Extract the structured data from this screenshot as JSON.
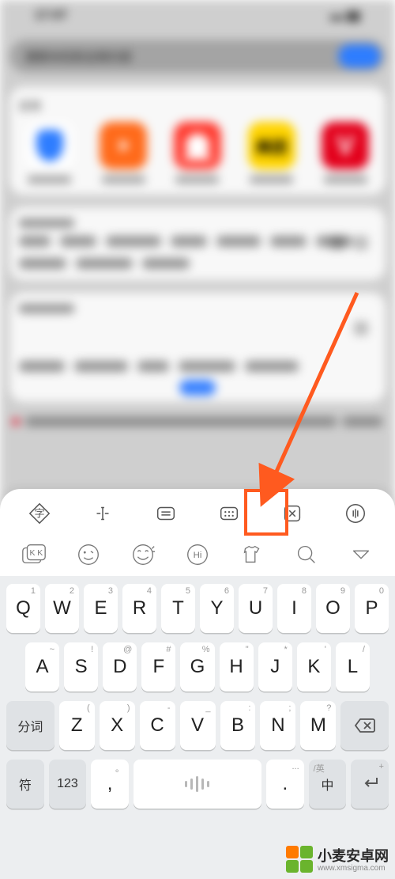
{
  "statusbar": {
    "time": "17:07"
  },
  "search": {
    "placeholder": "搜索本机和全网内容"
  },
  "apps_card": {
    "title": "应用",
    "items": [
      {
        "label": "手机管家",
        "icon": "shield-blue"
      },
      {
        "label": "华为视频",
        "icon": "play-orange"
      },
      {
        "label": "微博",
        "icon": "weibo-red"
      },
      {
        "label": "美团",
        "icon": "meituan-yellow"
      },
      {
        "label": "华为商城",
        "icon": "vmall-red"
      }
    ]
  },
  "toolbar1": [
    {
      "name": "zi-icon"
    },
    {
      "name": "cursor-icon"
    },
    {
      "name": "clipboard-icon"
    },
    {
      "name": "keyboard-icon"
    },
    {
      "name": "cut-icon"
    },
    {
      "name": "voice-icon"
    }
  ],
  "toolbar2": [
    {
      "name": "kk-icon"
    },
    {
      "name": "emoji-wink-icon"
    },
    {
      "name": "emoji-laugh-icon"
    },
    {
      "name": "hi-icon"
    },
    {
      "name": "tshirt-icon"
    },
    {
      "name": "search-icon"
    },
    {
      "name": "dropdown-icon"
    }
  ],
  "keyboard": {
    "row1": [
      {
        "main": "Q",
        "sup": "1"
      },
      {
        "main": "W",
        "sup": "2"
      },
      {
        "main": "E",
        "sup": "3"
      },
      {
        "main": "R",
        "sup": "4"
      },
      {
        "main": "T",
        "sup": "5"
      },
      {
        "main": "Y",
        "sup": "6"
      },
      {
        "main": "U",
        "sup": "7"
      },
      {
        "main": "I",
        "sup": "8"
      },
      {
        "main": "O",
        "sup": "9"
      },
      {
        "main": "P",
        "sup": "0"
      }
    ],
    "row2": [
      {
        "main": "A",
        "sup": "~"
      },
      {
        "main": "S",
        "sup": "!"
      },
      {
        "main": "D",
        "sup": "@"
      },
      {
        "main": "F",
        "sup": "#"
      },
      {
        "main": "G",
        "sup": "%"
      },
      {
        "main": "H",
        "sup": "\""
      },
      {
        "main": "J",
        "sup": "*"
      },
      {
        "main": "K",
        "sup": "'"
      },
      {
        "main": "L",
        "sup": "/"
      }
    ],
    "row3_left": "分词",
    "row3": [
      {
        "main": "Z",
        "sup": "("
      },
      {
        "main": "X",
        "sup": ")"
      },
      {
        "main": "C",
        "sup": "-"
      },
      {
        "main": "V",
        "sup": "_"
      },
      {
        "main": "B",
        "sup": ":"
      },
      {
        "main": "N",
        "sup": ";"
      },
      {
        "main": "M",
        "sup": "?"
      }
    ],
    "row4": {
      "sym": "符",
      "num": "123",
      "comma_main": ",",
      "comma_sup": "。",
      "period_main": ".",
      "period_sup": "...",
      "switch_main": "中",
      "switch_sup": "/英",
      "enter_sup": "+"
    }
  },
  "watermark": {
    "title": "小麦安卓网",
    "url": "www.xmsigma.com"
  }
}
